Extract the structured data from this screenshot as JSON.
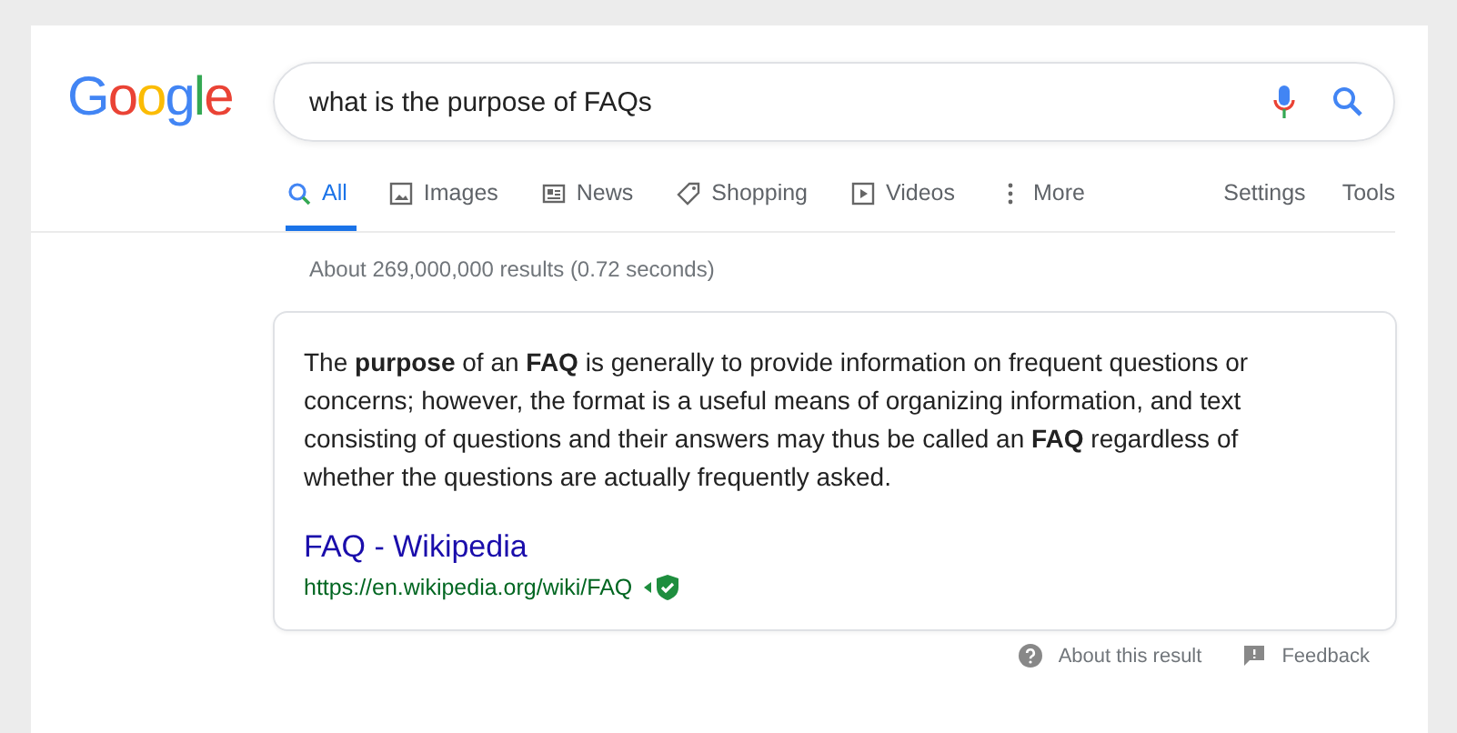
{
  "logo": "Google",
  "search": {
    "value": "what is the purpose of FAQs"
  },
  "tabs": [
    {
      "label": "All",
      "kind": "search",
      "selected": true
    },
    {
      "label": "Images",
      "kind": "image",
      "selected": false
    },
    {
      "label": "News",
      "kind": "news",
      "selected": false
    },
    {
      "label": "Shopping",
      "kind": "tag",
      "selected": false
    },
    {
      "label": "Videos",
      "kind": "play",
      "selected": false
    },
    {
      "label": "More",
      "kind": "dots",
      "selected": false
    }
  ],
  "tools": [
    "Settings",
    "Tools"
  ],
  "result_stats": "About 269,000,000 results (0.72 seconds)",
  "snippet": {
    "text": "The **purpose** of an **FAQ** is generally to provide information on frequent questions or concerns; however, the format is a useful means of organizing information, and text consisting of questions and their answers may thus be called an **FAQ** regardless of whether the questions are actually frequently asked.",
    "title": "FAQ - Wikipedia",
    "url": "https://en.wikipedia.org/wiki/FAQ"
  },
  "footer": [
    "About this result",
    "Feedback"
  ]
}
